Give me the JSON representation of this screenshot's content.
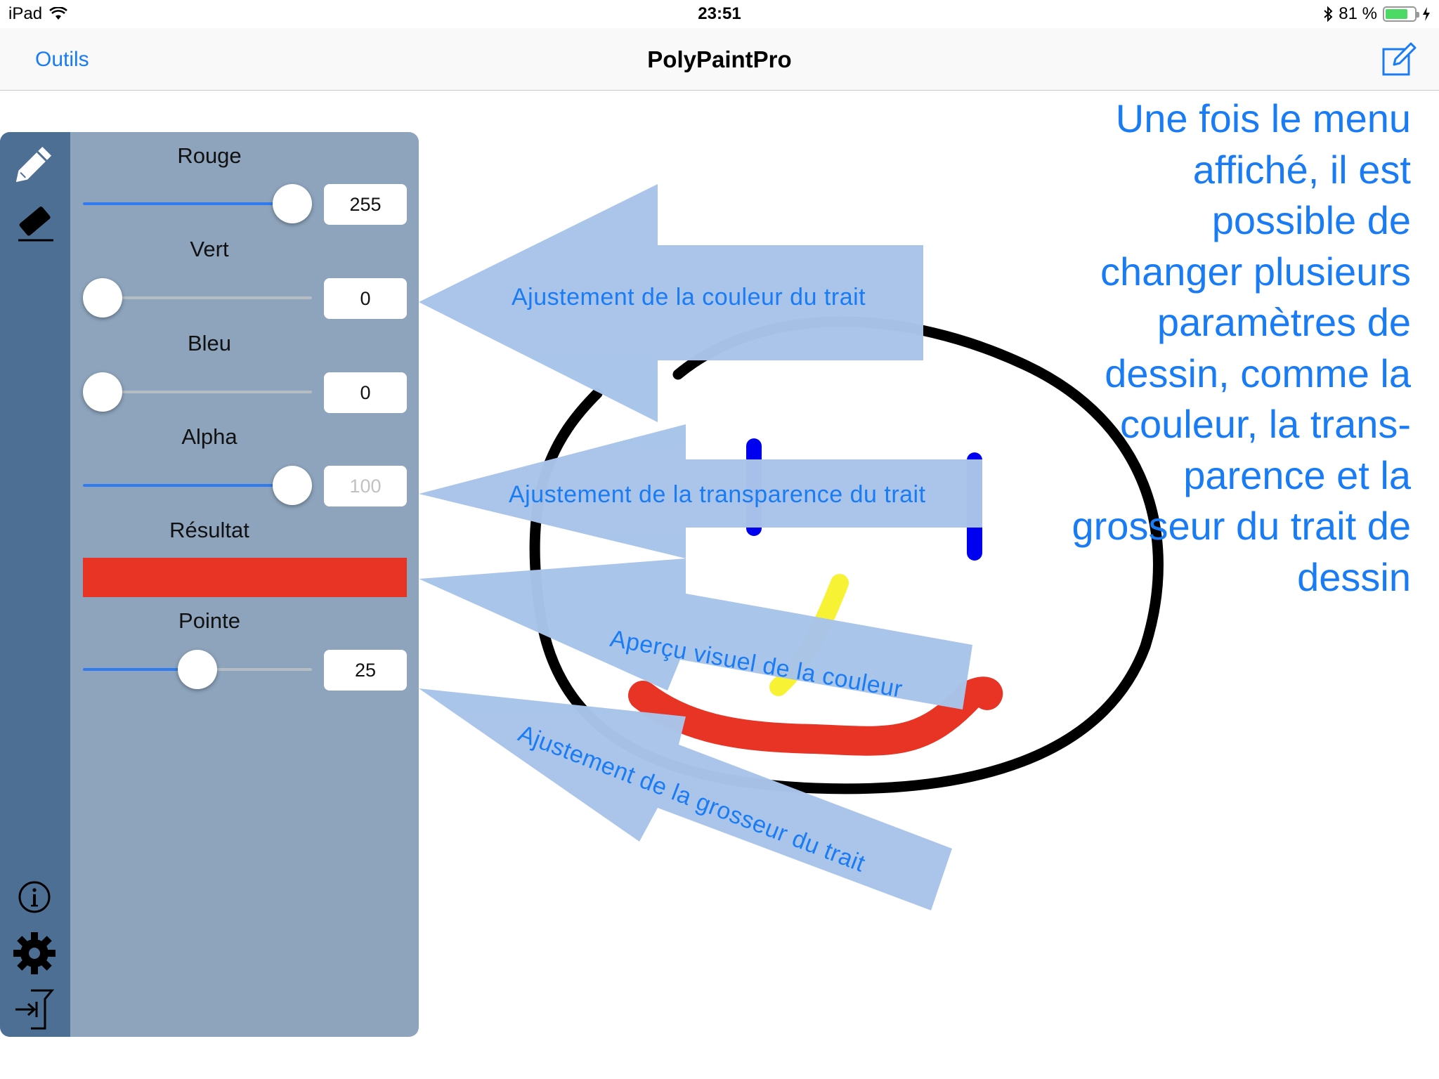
{
  "status_bar": {
    "device": "iPad",
    "time": "23:51",
    "battery": "81 %",
    "battery_level": 0.81
  },
  "nav_bar": {
    "left_button": "Outils",
    "title": "PolyPaintPro",
    "right_icon": "compose-icon"
  },
  "toolbar": {
    "tools": [
      "pencil-icon",
      "eraser-icon"
    ],
    "bottom_tools": [
      "info-icon",
      "gear-icon",
      "exit-icon"
    ]
  },
  "controls": {
    "red": {
      "label": "Rouge",
      "value": "255",
      "fraction": 1.0
    },
    "green": {
      "label": "Vert",
      "value": "0",
      "fraction": 0.0
    },
    "blue": {
      "label": "Bleu",
      "value": "0",
      "fraction": 0.0
    },
    "alpha": {
      "label": "Alpha",
      "value": "100",
      "fraction": 1.0
    },
    "result": {
      "label": "Résultat",
      "color": "#e83425"
    },
    "tip": {
      "label": "Pointe",
      "value": "25",
      "fraction": 0.5
    }
  },
  "annotations": {
    "color": "Ajustement de la couleur du trait",
    "alpha": "Ajustement de la transparence du trait",
    "preview": "Aperçu visuel de la couleur",
    "size": "Ajustement de la grosseur du trait"
  },
  "info_lines": [
    "Une fois le menu",
    "affiché, il est",
    "possible de",
    "changer plusieurs",
    "paramètres de",
    "dessin, comme la",
    "couleur, la trans-",
    "parence et la",
    "grosseur du trait de",
    "dessin"
  ],
  "colors": {
    "accent": "#1a7cf5",
    "panel": "#8da4bc",
    "toolbar": "#4d6f94",
    "arrow": "#a9c4ea"
  }
}
